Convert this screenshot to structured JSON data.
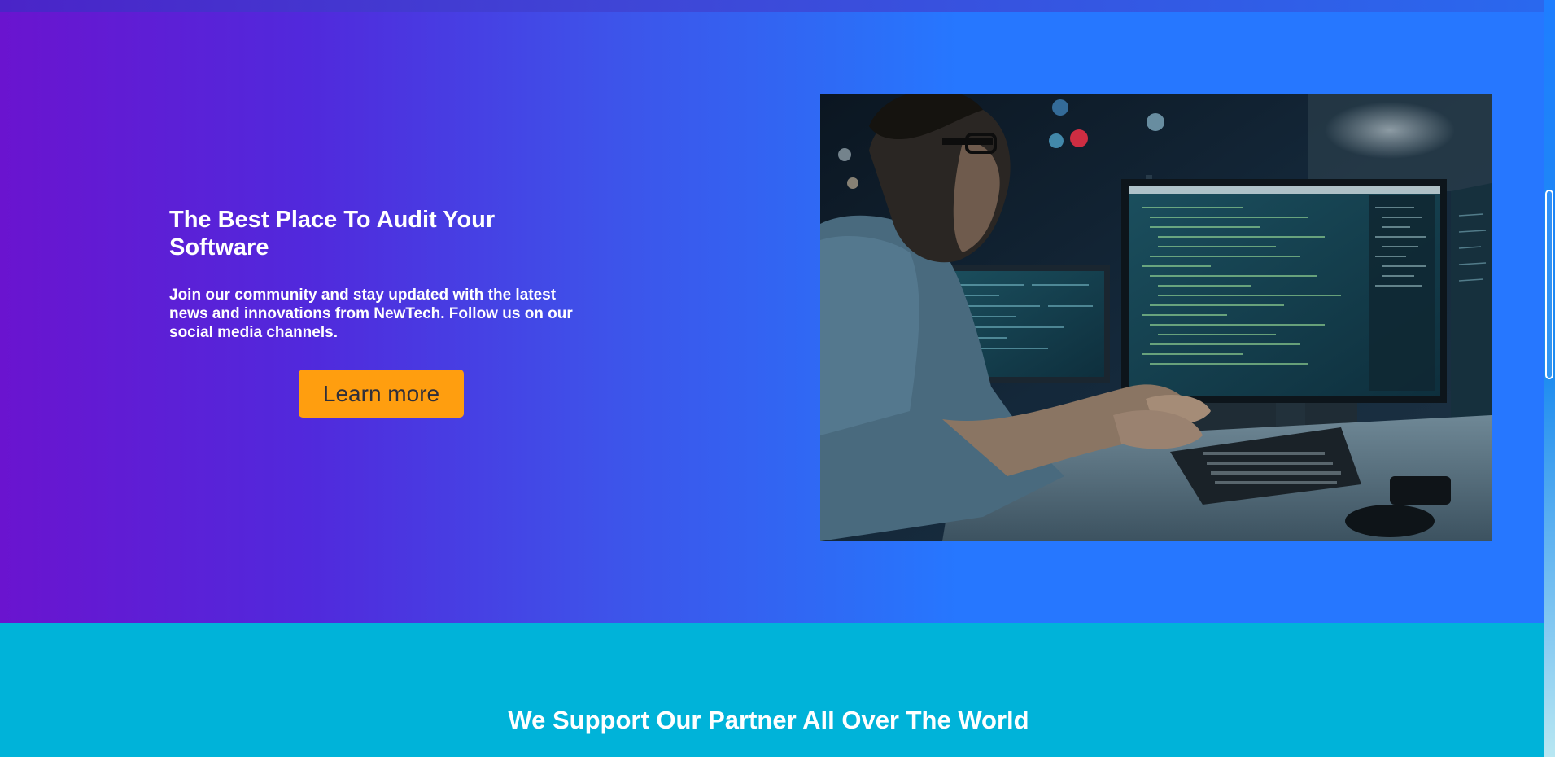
{
  "hero": {
    "title": "The Best Place To Audit Your Software",
    "description": "Join our community and stay updated with the latest news and innovations from NewTech. Follow us on our social media channels.",
    "button_label": "Learn more",
    "image_alt": "developer-coding-at-monitors-photo"
  },
  "partners": {
    "title": "We Support Our Partner All Over The World"
  },
  "colors": {
    "hero_gradient_start": "#6a14cf",
    "hero_gradient_end": "#2677ff",
    "button_bg": "#ff9e0f",
    "button_text": "#2f2f3a",
    "partners_bg": "#00b3d9",
    "text": "#ffffff"
  }
}
